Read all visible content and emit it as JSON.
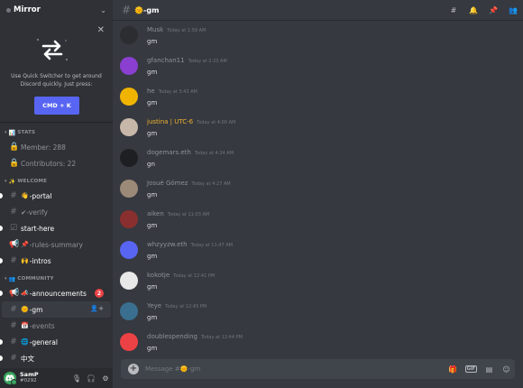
{
  "server": {
    "name": "Mirror"
  },
  "popout": {
    "message": "Use Quick Switcher to get around Discord quickly. Just press:",
    "button": "CMD + K"
  },
  "categories": {
    "stats": "STATS",
    "welcome": "WELCOME",
    "community": "COMMUNITY"
  },
  "channels": {
    "members": "Member: 288",
    "contributors": "Contributors: 22",
    "portal": "-portal",
    "verify": "✔-verify",
    "start_here": "start-here",
    "rules": "-rules-summary",
    "intros": "-intros",
    "announcements": "-announcements",
    "announcements_badge": "2",
    "gm": "-gm",
    "events": "-events",
    "general": "-general",
    "chinese": "中文"
  },
  "user": {
    "name": "SamP",
    "discriminator": "#0292"
  },
  "header": {
    "title": "-gm"
  },
  "messages": [
    {
      "author": "Musk",
      "time": "Today at 1:59 AM",
      "text": "gm",
      "avatar_color": "#2b2d31"
    },
    {
      "author": "gfanchan11",
      "time": "Today at 2:23 AM",
      "text": "gm",
      "avatar_color": "#8a3fd1"
    },
    {
      "author": "he",
      "time": "Today at 3:43 AM",
      "text": "gm",
      "avatar_color": "#f0b400"
    },
    {
      "author": "justina | UTC-6",
      "time": "Today at 4:00 AM",
      "text": "gm",
      "avatar_color": "#c7b7a8",
      "author_color": "#f0b232"
    },
    {
      "author": "dogemars.eth",
      "time": "Today at 4:24 AM",
      "text": "gn",
      "avatar_color": "#1e1f22"
    },
    {
      "author": "Josué Gómez",
      "time": "Today at 4:27 AM",
      "text": "gm",
      "avatar_color": "#9c8a78"
    },
    {
      "author": "aiken",
      "time": "Today at 11:03 AM",
      "text": "gm",
      "avatar_color": "#8a2f2f"
    },
    {
      "author": "whzyyzw.eth",
      "time": "Today at 11:47 AM",
      "text": "gm",
      "avatar_color": "#5865f2"
    },
    {
      "author": "kokotje",
      "time": "Today at 12:41 PM",
      "text": "gm",
      "avatar_color": "#e8e8e8"
    },
    {
      "author": "Yeye",
      "time": "Today at 12:43 PM",
      "text": "gm",
      "avatar_color": "#3a6f8f"
    },
    {
      "author": "doublespending",
      "time": "Today at 12:44 PM",
      "text": "gm",
      "avatar_color": "#ed4245"
    }
  ],
  "composer": {
    "placeholder": "Message #🌞-gm"
  }
}
